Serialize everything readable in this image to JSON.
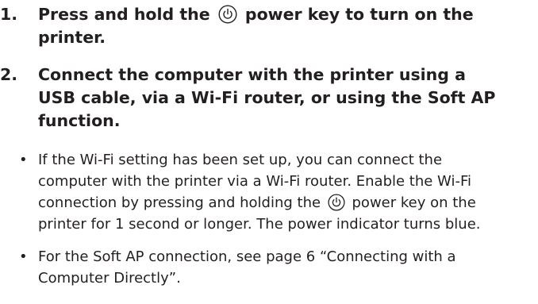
{
  "steps": [
    {
      "number": "1.",
      "lines": [
        [
          "Press and hold the",
          "power key to turn on the"
        ],
        [
          "printer."
        ]
      ]
    },
    {
      "number": "2.",
      "lines": [
        [
          "Connect the computer with the printer using a"
        ],
        [
          "USB cable, via a Wi-Fi router, or using the Soft AP"
        ],
        [
          "function."
        ]
      ]
    }
  ],
  "bullets": [
    {
      "marker": "•",
      "lines": [
        [
          "If the Wi-Fi setting has been set up, you can connect the"
        ],
        [
          "computer with the printer via a Wi-Fi router. Enable the Wi-Fi"
        ],
        [
          "connection by pressing and holding the",
          "power key on the"
        ],
        [
          "printer for 1 second or longer. The power indicator turns blue."
        ]
      ]
    },
    {
      "marker": "•",
      "lines": [
        [
          "For the Soft AP connection, see page 6 “Connecting with a"
        ],
        [
          "Computer Directly”."
        ]
      ]
    }
  ],
  "icons": {
    "power": "power-key-icon"
  }
}
